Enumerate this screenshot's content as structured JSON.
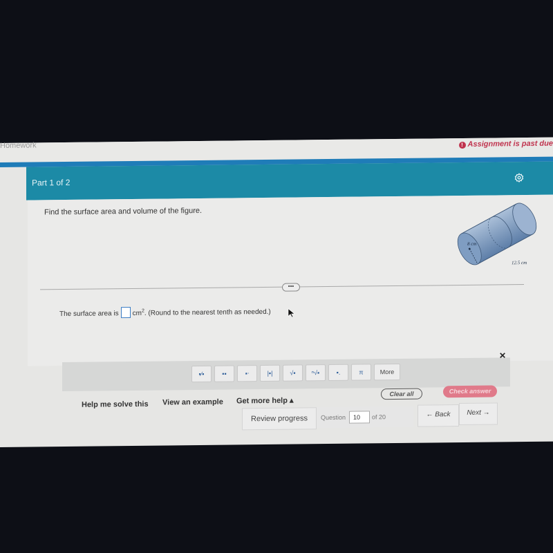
{
  "topbar": {
    "app_name": "Homework",
    "alert_icon": "exclamation-circle-icon",
    "alert_text": "Assignment is past due"
  },
  "part_header": {
    "label": "Part 1 of 2",
    "settings_icon": "gear-icon"
  },
  "question": {
    "prompt": "Find the surface area and volume of the figure.",
    "figure": {
      "type": "cylinder",
      "radius_label": "8 cm",
      "length_label": "12.5 cm"
    },
    "divider_handle": "•••"
  },
  "answer": {
    "prefix": "The surface area is",
    "value": "",
    "unit": "cm",
    "unit_exponent": "2",
    "suffix": ". (Round to the nearest tenth as needed.)"
  },
  "math_palette": {
    "close_label": "✕",
    "buttons": [
      {
        "name": "fraction",
        "glyph": "▪⁄▪"
      },
      {
        "name": "mixed-number",
        "glyph": "▪▪"
      },
      {
        "name": "exponent",
        "glyph": "▪ᐧ"
      },
      {
        "name": "absolute-value",
        "glyph": "|▪|"
      },
      {
        "name": "square-root",
        "glyph": "√▪"
      },
      {
        "name": "nth-root",
        "glyph": "ⁿ√▪"
      },
      {
        "name": "decimal",
        "glyph": "▪."
      },
      {
        "name": "pi",
        "glyph": "π"
      },
      {
        "name": "more",
        "glyph": "More"
      }
    ]
  },
  "help": {
    "help_me_solve": "Help me solve this",
    "view_example": "View an example",
    "get_more_help": "Get more help ▴",
    "clear_all": "Clear all",
    "check_answer": "Check answer"
  },
  "navigation": {
    "review_progress": "Review progress",
    "question_label": "Question",
    "question_number": "10",
    "of_total": "of 20",
    "back": "← Back",
    "next": "Next →"
  }
}
